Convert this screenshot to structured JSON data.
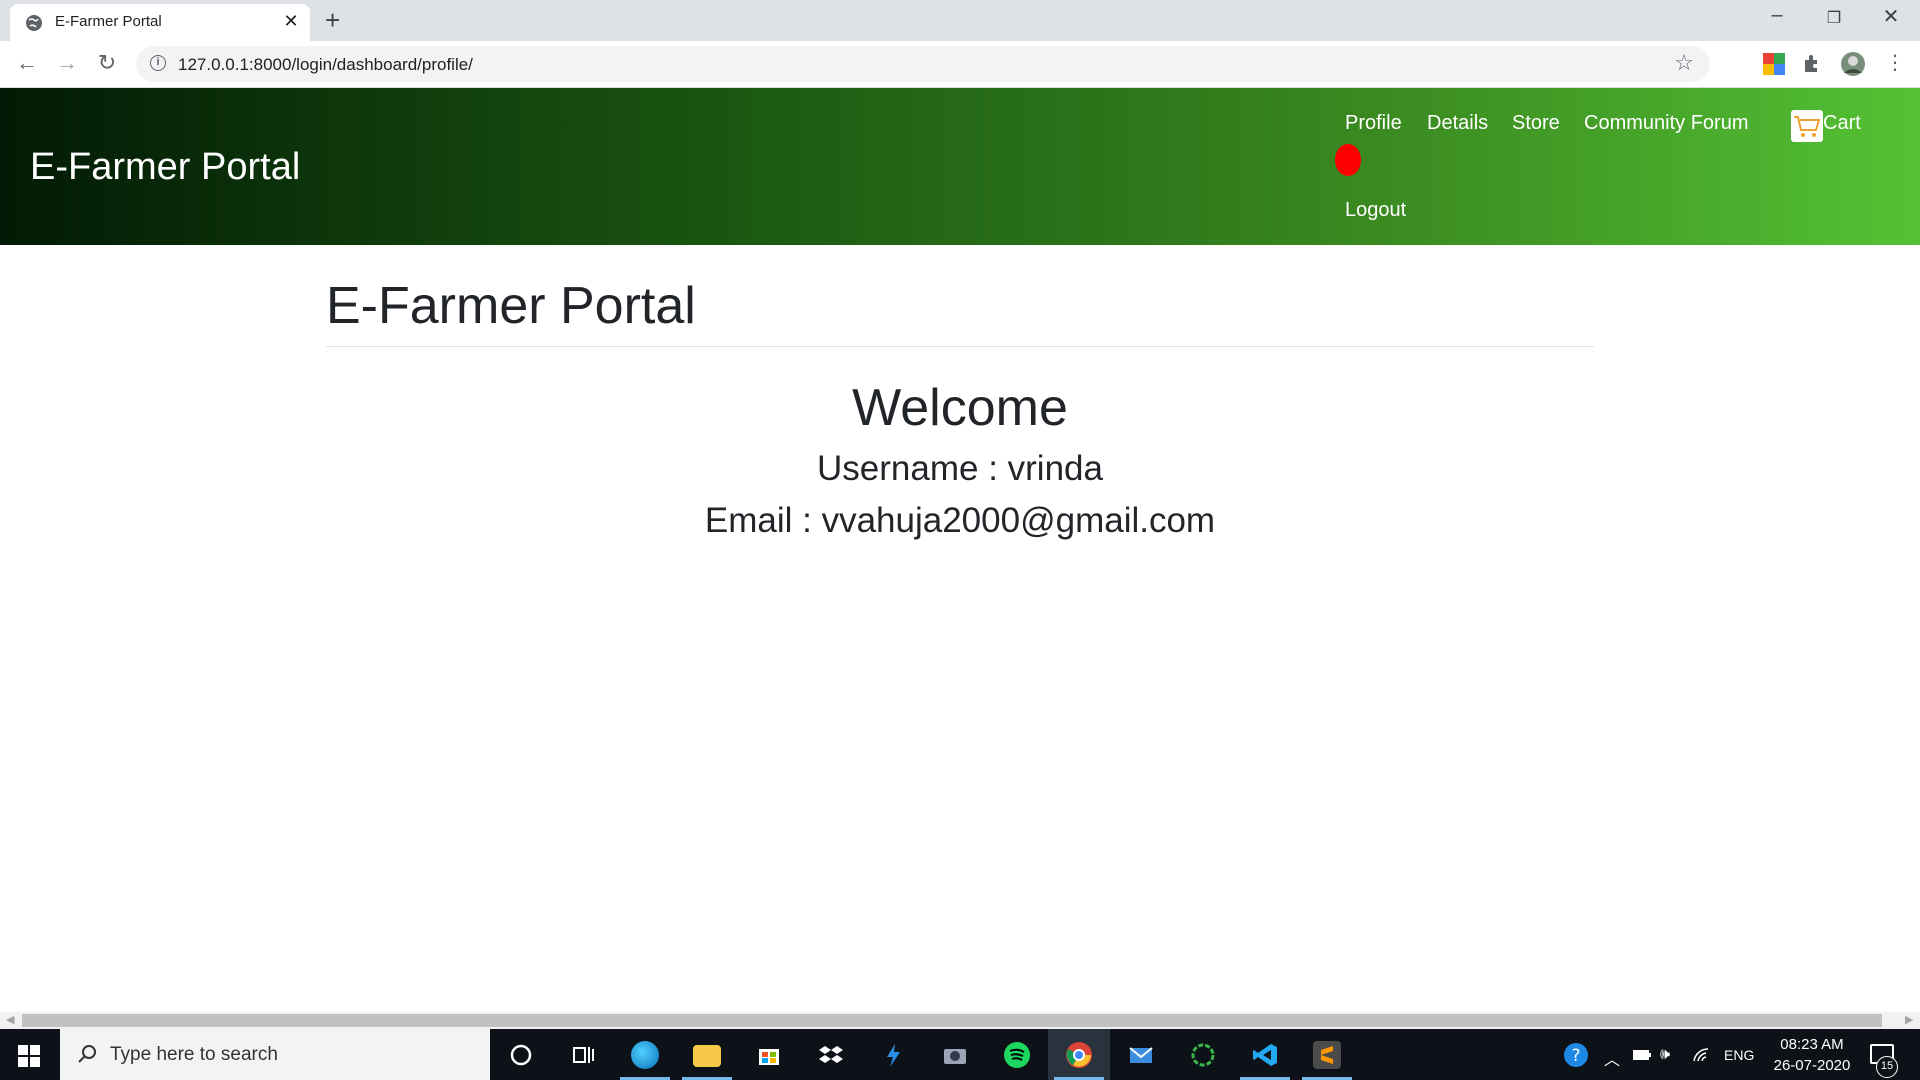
{
  "browser": {
    "tab_title": "E-Farmer Portal",
    "url": "127.0.0.1:8000/login/dashboard/profile/"
  },
  "header": {
    "brand": "E-Farmer Portal",
    "nav": {
      "profile": "Profile",
      "details": "Details",
      "store": "Store",
      "community_forum": "Community Forum",
      "cart": "Cart",
      "logout": "Logout"
    }
  },
  "main": {
    "title": "E-Farmer Portal",
    "welcome": "Welcome",
    "username_line": "Username : vrinda",
    "email_line": "Email : vvahuja2000@gmail.com"
  },
  "taskbar": {
    "search_placeholder": "Type here to search",
    "language": "ENG",
    "time": "08:23 AM",
    "date": "26-07-2020",
    "notification_count": "15"
  },
  "colors": {
    "header_gradient_start": "#021a05",
    "header_gradient_end": "#54c234",
    "text_dark": "#212529",
    "notification_dot": "#ff0000"
  }
}
